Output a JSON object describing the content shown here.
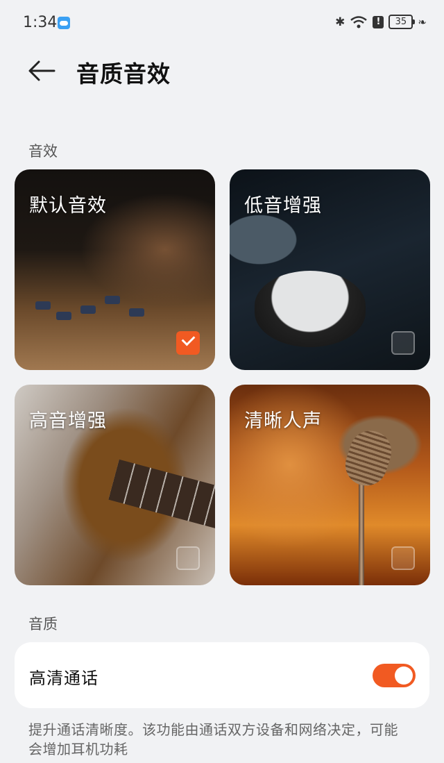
{
  "status": {
    "time": "1:34",
    "battery": "35"
  },
  "header": {
    "title": "音质音效"
  },
  "effects": {
    "section_label": "音效",
    "cards": [
      {
        "label": "默认音效",
        "selected": true
      },
      {
        "label": "低音增强",
        "selected": false
      },
      {
        "label": "高音增强",
        "selected": false
      },
      {
        "label": "清晰人声",
        "selected": false
      }
    ]
  },
  "quality": {
    "section_label": "音质",
    "hd_call": {
      "label": "高清通话",
      "enabled": true
    },
    "description": "提升通话清晰度。该功能由通话双方设备和网络决定，可能会增加耳机功耗"
  },
  "colors": {
    "accent": "#f15a22",
    "background": "#f1f2f4"
  }
}
